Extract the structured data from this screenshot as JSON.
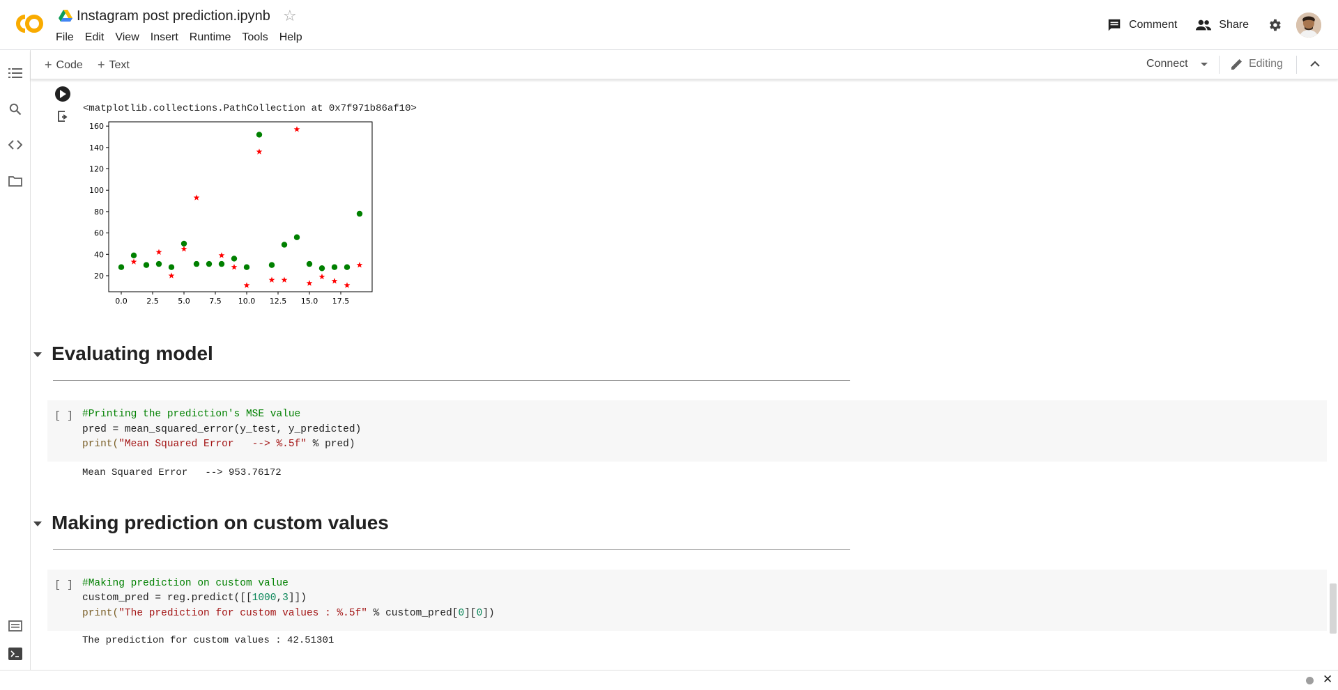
{
  "app": {
    "logo_text": "CO",
    "notebook_title": "Instagram post prediction.ipynb",
    "menu": [
      "File",
      "Edit",
      "View",
      "Insert",
      "Runtime",
      "Tools",
      "Help"
    ],
    "comment_label": "Comment",
    "share_label": "Share"
  },
  "toolbar": {
    "add_code_label": "Code",
    "add_text_label": "Text",
    "connect_label": "Connect",
    "editing_label": "Editing"
  },
  "output_cell": {
    "repr_text": "<matplotlib.collections.PathCollection at 0x7f971b86af10>"
  },
  "chart_data": {
    "type": "scatter",
    "xlim": [
      -1,
      20
    ],
    "ylim": [
      5,
      164
    ],
    "xticks": [
      "0.0",
      "2.5",
      "5.0",
      "7.5",
      "10.0",
      "12.5",
      "15.0",
      "17.5"
    ],
    "yticks": [
      "20",
      "40",
      "60",
      "80",
      "100",
      "120",
      "140",
      "160"
    ],
    "xtick_values": [
      0,
      2.5,
      5,
      7.5,
      10,
      12.5,
      15,
      17.5
    ],
    "ytick_values": [
      20,
      40,
      60,
      80,
      100,
      120,
      140,
      160
    ],
    "series": [
      {
        "marker": "circle",
        "color": "#008000",
        "x": [
          0,
          1,
          2,
          3,
          4,
          5,
          6,
          7,
          8,
          9,
          10,
          11,
          12,
          13,
          14,
          15,
          16,
          17,
          18,
          19
        ],
        "y": [
          28,
          39,
          30,
          31,
          28,
          50,
          31,
          31,
          31,
          36,
          28,
          152,
          30,
          49,
          56,
          31,
          27,
          28,
          28,
          78
        ]
      },
      {
        "marker": "star",
        "color": "#ff0000",
        "x": [
          1,
          3,
          4,
          5,
          6,
          8,
          9,
          10,
          11,
          12,
          13,
          14,
          15,
          16,
          17,
          18,
          19
        ],
        "y": [
          33,
          42,
          20,
          45,
          93,
          39,
          28,
          11,
          136,
          16,
          16,
          157,
          13,
          19,
          15,
          11,
          30
        ]
      }
    ]
  },
  "sections": [
    {
      "heading": "Evaluating model",
      "cell": {
        "bracket": "[ ]",
        "comment": "#Printing the prediction's MSE value",
        "line2": "pred = mean_squared_error(y_test, y_predicted)",
        "line3_fn": "print(",
        "line3_str": "\"Mean Squared Error   --> %.5f\"",
        "line3_rest": " % pred)"
      },
      "output": "Mean Squared Error   --> 953.76172"
    },
    {
      "heading": "Making prediction on custom values",
      "cell": {
        "bracket": "[ ]",
        "comment": "#Making prediction on custom value",
        "line2_a": "custom_pred = reg.predict([[",
        "line2_n1": "1000",
        "line2_b": ",",
        "line2_n2": "3",
        "line2_c": "]])",
        "line3_fn": "print(",
        "line3_str": "\"The prediction for custom values : %.5f\"",
        "line3_a": " % custom_pred[",
        "line3_n1": "0",
        "line3_b": "][",
        "line3_n2": "0",
        "line3_c": "])"
      },
      "output": "The prediction for custom values : 42.51301"
    }
  ],
  "colors": {
    "logo_orange": "#F9AB00",
    "code_comment": "#008000",
    "code_string": "#a31515",
    "code_number": "#098658"
  }
}
